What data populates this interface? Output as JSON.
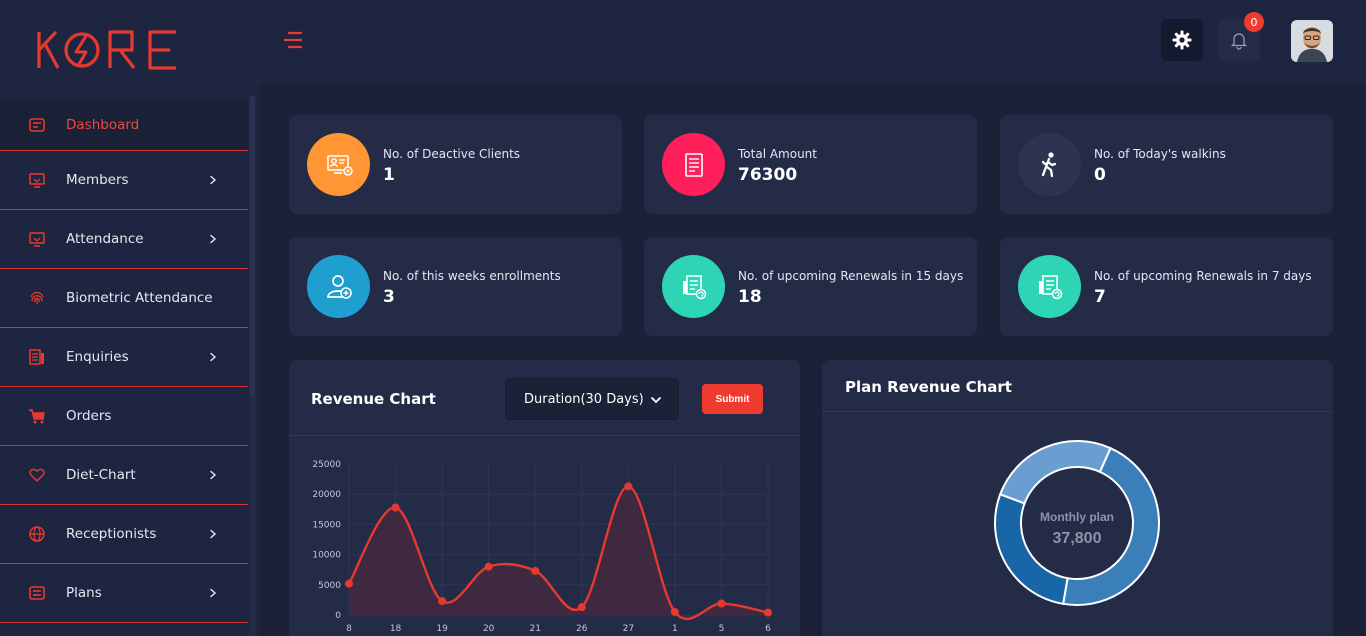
{
  "app": {
    "logo_text": "KORE"
  },
  "sidebar": {
    "items": [
      {
        "label": "Dashboard",
        "icon": "dashboard-icon",
        "chevron": false
      },
      {
        "label": "Members",
        "icon": "monitor-icon",
        "chevron": true
      },
      {
        "label": "Attendance",
        "icon": "monitor-icon",
        "chevron": true
      },
      {
        "label": "Biometric Attendance",
        "icon": "fingerprint-icon",
        "chevron": false
      },
      {
        "label": "Enquiries",
        "icon": "enquiry-icon",
        "chevron": true
      },
      {
        "label": "Orders",
        "icon": "cart-icon",
        "chevron": false
      },
      {
        "label": "Diet-Chart",
        "icon": "heart-icon",
        "chevron": true
      },
      {
        "label": "Receptionists",
        "icon": "globe-icon",
        "chevron": true
      },
      {
        "label": "Plans",
        "icon": "plans-icon",
        "chevron": true
      }
    ]
  },
  "topbar": {
    "notification_count": "0"
  },
  "stats": [
    {
      "label": "No. of Deactive Clients",
      "value": "1",
      "color": "#ff9533",
      "icon": "deactive-client-icon"
    },
    {
      "label": "Total Amount",
      "value": "76300",
      "color": "#ff1f5a",
      "icon": "invoice-icon"
    },
    {
      "label": "No. of Today's walkins",
      "value": "0",
      "color": "#2c3452",
      "icon": "walking-icon"
    },
    {
      "label": "No. of this weeks enrollments",
      "value": "3",
      "color": "#1e9fd0",
      "icon": "add-user-icon"
    },
    {
      "label": "No. of upcoming Renewals in 15 days",
      "value": "18",
      "color": "#2ed5b5",
      "icon": "renewal-icon"
    },
    {
      "label": "No. of upcoming Renewals in 7 days",
      "value": "7",
      "color": "#2ed5b5",
      "icon": "renewal-icon"
    }
  ],
  "revenue_panel": {
    "title": "Revenue Chart",
    "duration_select": "Duration(30 Days)",
    "submit_label": "Submit"
  },
  "plan_panel": {
    "title": "Plan Revenue Chart"
  },
  "chart_data": [
    {
      "type": "area",
      "title": "Revenue Chart",
      "categories": [
        "8",
        "18",
        "19",
        "20",
        "21",
        "26",
        "27",
        "1",
        "5",
        "6"
      ],
      "series": [
        {
          "values": [
            5200,
            17800,
            2300,
            8000,
            7300,
            1300,
            21300,
            500,
            1900,
            400
          ]
        }
      ],
      "y_ticks": [
        "25000",
        "20000",
        "15000",
        "10000",
        "5000",
        "0"
      ],
      "ylim": [
        0,
        25000
      ],
      "grid": true,
      "colors": {
        "line": "#e8392e",
        "fill": "#4a2a40"
      }
    },
    {
      "type": "pie",
      "title": "Plan Revenue Chart",
      "center_label": "Monthly plan",
      "center_value": "37,800",
      "slices": [
        {
          "value": 46,
          "color": "#3a7fba"
        },
        {
          "value": 28,
          "color": "#1866a8"
        },
        {
          "value": 26,
          "color": "#6b9ed0"
        }
      ]
    }
  ]
}
